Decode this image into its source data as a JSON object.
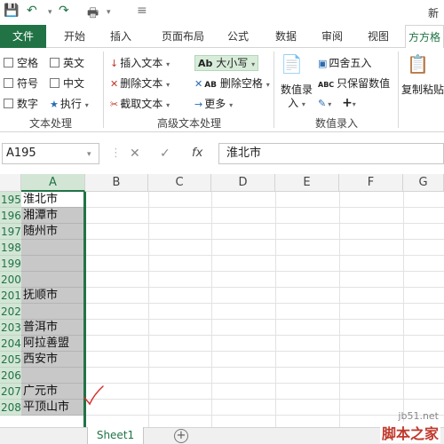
{
  "title": "新",
  "tabs": [
    "文件",
    "开始",
    "插入",
    "页面布局",
    "公式",
    "数据",
    "审阅",
    "视图",
    "方方格"
  ],
  "ribbon": {
    "text_processing": {
      "items": [
        "空格",
        "英文",
        "符号",
        "中文",
        "数字",
        "执行"
      ],
      "label": "文本处理"
    },
    "advanced_text": {
      "insert": "插入文本",
      "delete": "删除文本",
      "extract": "截取文本",
      "case": "大小写",
      "case_prefix": "Ab",
      "remove_space": "删除空格",
      "remove_space_prefix": "AB",
      "more": "更多",
      "label": "高级文本处理"
    },
    "numeric": {
      "input": "数值录入",
      "round": "四舍五入",
      "keep": "只保留数值",
      "round_prefix": "ABC",
      "label": "数值录入"
    },
    "paste": "复制粘贴"
  },
  "formula": {
    "name_box": "A195",
    "fx": "fx",
    "content": "淮北市"
  },
  "columns": [
    "A",
    "B",
    "C",
    "D",
    "E",
    "F",
    "G"
  ],
  "rows": [
    {
      "num": "195",
      "a": "淮北市"
    },
    {
      "num": "196",
      "a": "湘潭市"
    },
    {
      "num": "197",
      "a": "随州市"
    },
    {
      "num": "198",
      "a": ""
    },
    {
      "num": "199",
      "a": ""
    },
    {
      "num": "200",
      "a": ""
    },
    {
      "num": "201",
      "a": "抚顺市"
    },
    {
      "num": "202",
      "a": ""
    },
    {
      "num": "203",
      "a": "普洱市"
    },
    {
      "num": "204",
      "a": "阿拉善盟"
    },
    {
      "num": "205",
      "a": "西安市"
    },
    {
      "num": "206",
      "a": ""
    },
    {
      "num": "207",
      "a": "广元市"
    },
    {
      "num": "208",
      "a": "平顶山市"
    }
  ],
  "sheet": {
    "name": "Sheet1",
    "add": "+"
  },
  "watermark": {
    "site": "jb51.net",
    "brand": "脚本之家"
  },
  "colors": {
    "accent": "#217346",
    "selection": "#c8c8c8"
  }
}
